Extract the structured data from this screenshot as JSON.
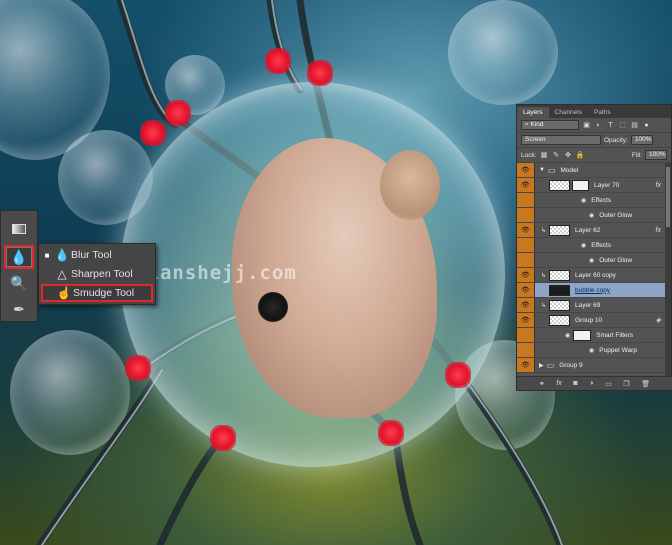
{
  "tools_panel": {
    "flyout": {
      "items": [
        {
          "label": "Blur Tool",
          "icon": "blur-drop-icon",
          "selected": false,
          "active_bullet": "■"
        },
        {
          "label": "Sharpen Tool",
          "icon": "sharpen-triangle-icon",
          "selected": false,
          "active_bullet": ""
        },
        {
          "label": "Smudge Tool",
          "icon": "smudge-finger-icon",
          "selected": true,
          "active_bullet": ""
        }
      ]
    }
  },
  "watermark": "baoyuandianshejj.com",
  "layers_panel": {
    "tabs": [
      "Layers",
      "Channels",
      "Paths"
    ],
    "filter_kind": "Kind",
    "blend_mode": "Screen",
    "opacity_label": "Opacity:",
    "opacity_value": "100%",
    "lock_label": "Lock:",
    "fill_label": "Fill:",
    "fill_value": "100%",
    "layers": [
      {
        "name": "Model",
        "type": "group"
      },
      {
        "name": "Layer 70",
        "type": "layer",
        "fx": "fx"
      },
      {
        "name": "Effects",
        "type": "effect"
      },
      {
        "name": "Outer Glow",
        "type": "effect"
      },
      {
        "name": "Layer 62",
        "type": "layer",
        "fx": "fx"
      },
      {
        "name": "Effects",
        "type": "effect"
      },
      {
        "name": "Outer Glow",
        "type": "effect"
      },
      {
        "name": "Layer 60 copy",
        "type": "layer"
      },
      {
        "name": "bubble copy",
        "type": "layer",
        "selected": true
      },
      {
        "name": "Layer 69",
        "type": "layer"
      },
      {
        "name": "Group 10",
        "type": "smart"
      },
      {
        "name": "Smart Filters",
        "type": "effect"
      },
      {
        "name": "Puppet Warp",
        "type": "effect"
      },
      {
        "name": "Group 9",
        "type": "group"
      }
    ],
    "footer_icons": [
      "link-icon",
      "fx-icon",
      "mask-icon",
      "adjustment-icon",
      "folder-icon",
      "new-layer-icon",
      "trash-icon"
    ]
  },
  "colors": {
    "highlight_red": "#e1262c",
    "visibility_column": "#c8781f",
    "selected_layer": "#8ea6c6"
  }
}
